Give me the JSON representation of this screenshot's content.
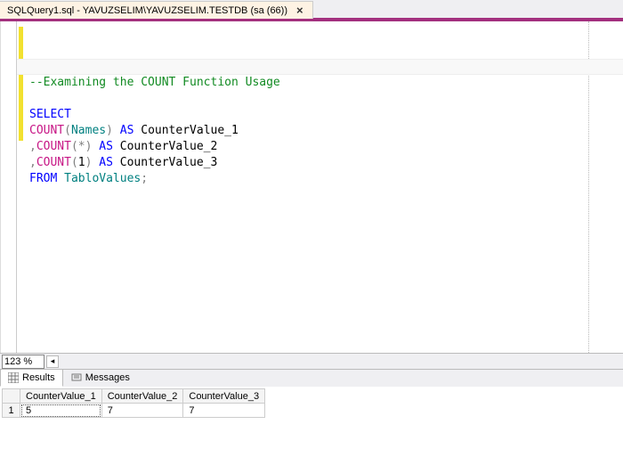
{
  "tab": {
    "title": "SQLQuery1.sql - YAVUZSELIM\\YAVUZSELIM.TESTDB (sa (66))"
  },
  "code": {
    "comment": "--Examining the COUNT Function Usage",
    "select": "SELECT",
    "count1a": "COUNT",
    "count1b": "(",
    "count1c": "Names",
    "count1d": ")",
    "as1": " AS",
    "alias1": " CounterValue_1",
    "comma2": ",",
    "count2a": "COUNT",
    "count2b": "(",
    "count2c": "*",
    "count2d": ")",
    "as2": " AS",
    "alias2": " CounterValue_2",
    "comma3": ",",
    "count3a": "COUNT",
    "count3b": "(",
    "count3c": "1",
    "count3d": ")",
    "as3": " AS",
    "alias3": " CounterValue_3",
    "from": "FROM",
    "table": " TabloValues",
    "semi": ";"
  },
  "zoom": {
    "level": "123 %"
  },
  "resultTabs": {
    "results": "Results",
    "messages": "Messages"
  },
  "grid": {
    "rownum_header": "",
    "headers": [
      "CounterValue_1",
      "CounterValue_2",
      "CounterValue_3"
    ],
    "row1_num": "1",
    "row1": [
      "5",
      "7",
      "7"
    ]
  }
}
